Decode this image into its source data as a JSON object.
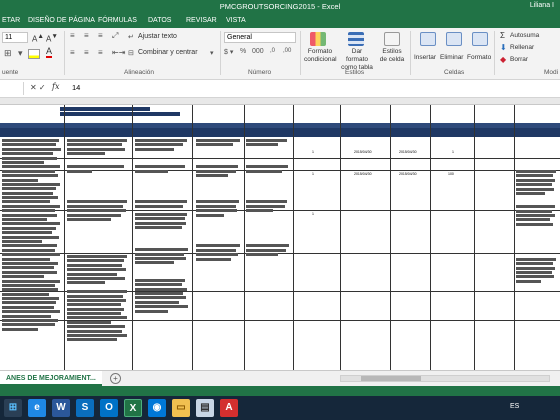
{
  "window": {
    "title": "PMCGROUTSORCING2015 - Excel",
    "user": "Liliana I"
  },
  "tabs": [
    "ETAR",
    "DISEÑO DE PÁGINA",
    "FÓRMULAS",
    "DATOS",
    "REVISAR",
    "VISTA"
  ],
  "ribbon": {
    "font_size": "11",
    "wrap_text": "Ajustar texto",
    "merge_center": "Combinar y centrar",
    "number_format": "General",
    "format_conditional": "Formato condicional",
    "format_table": "Dar formato como tabla",
    "cell_styles": "Estilos de celda",
    "insert": "Insertar",
    "delete": "Eliminar",
    "format": "Formato",
    "autosum": "Autosuma",
    "fill": "Rellenar",
    "clear": "Borrar",
    "groups": {
      "font": "uente",
      "alignment": "Alineación",
      "number": "Número",
      "styles": "Estilos",
      "cells": "Celdas",
      "modify": "Modi"
    }
  },
  "formula_bar": {
    "fx": "fx",
    "value": "14"
  },
  "sheet": {
    "cell_values": [
      "1",
      "2015/04/30",
      "2015/04/30",
      "1",
      "1",
      "1",
      "2015/04/30",
      "2015/04/30",
      "100"
    ]
  },
  "sheet_tabs": {
    "active": "ANES DE MEJORAMIENT...",
    "add_label": "+"
  },
  "taskbar": {
    "language": "ES"
  }
}
